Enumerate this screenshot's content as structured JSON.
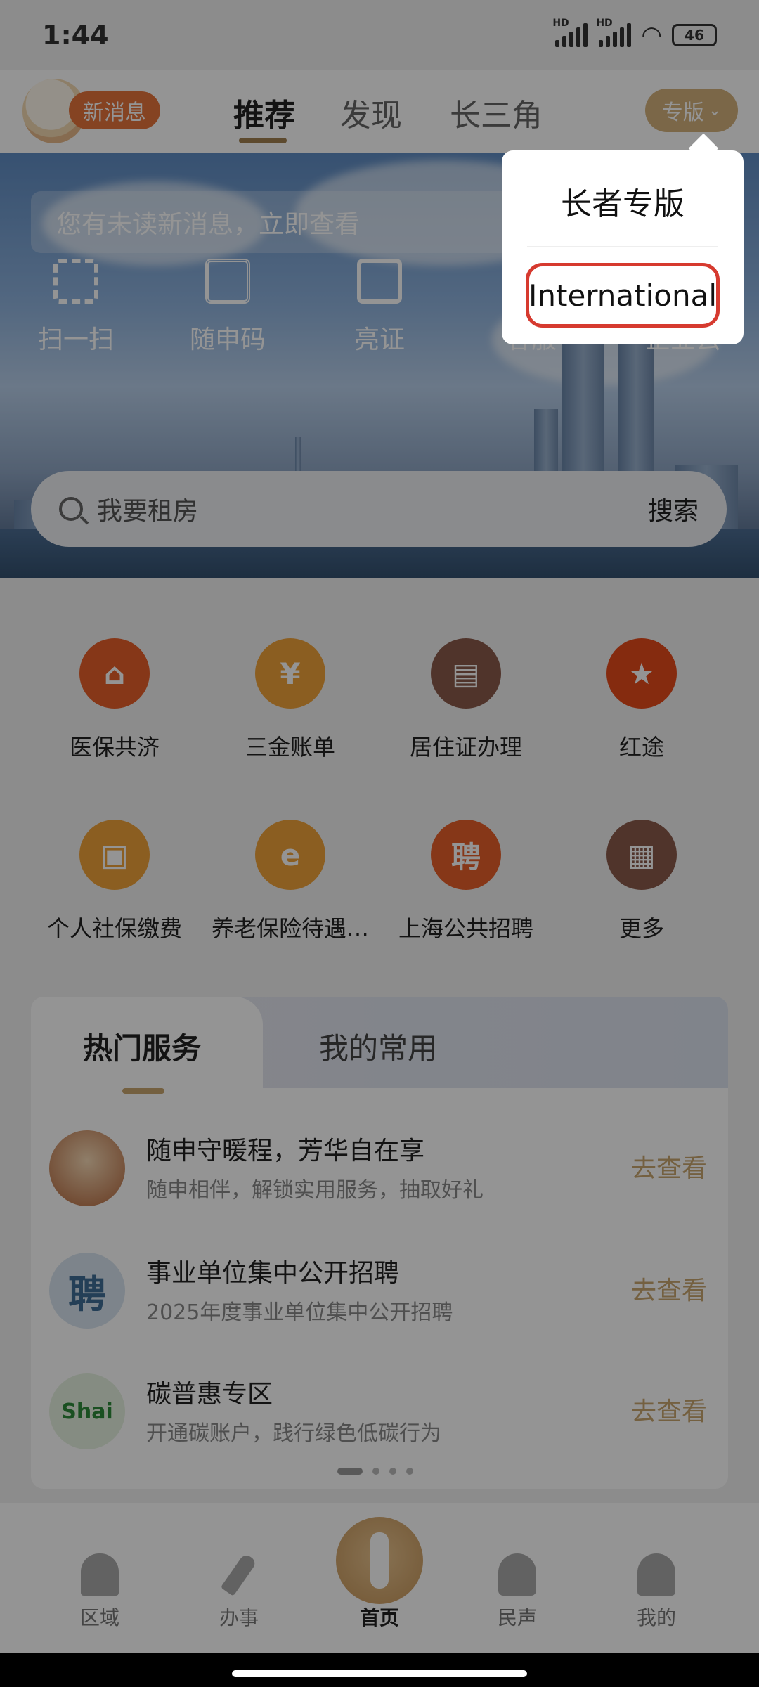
{
  "status_bar": {
    "time": "1:44",
    "battery": "46",
    "net1": "HD",
    "net2": "HD"
  },
  "top_nav": {
    "message_badge": "新消息",
    "tabs": [
      {
        "label": "推荐"
      },
      {
        "label": "发现"
      },
      {
        "label": "长三角"
      }
    ],
    "edition_button": "专版"
  },
  "banner": {
    "notice": "您有未读新消息，立即查看",
    "quick_actions": [
      {
        "label": "扫一扫",
        "icon": "scan-icon"
      },
      {
        "label": "随申码",
        "icon": "qr-code-icon"
      },
      {
        "label": "亮证",
        "icon": "id-card-icon"
      },
      {
        "label": "客服",
        "icon": "customer-service-icon"
      },
      {
        "label": "企业云",
        "icon": "enterprise-cloud-icon"
      }
    ],
    "search_placeholder": "我要租房",
    "search_button": "搜索"
  },
  "services": [
    {
      "label": "医保共济",
      "icon": "medical-insurance-icon",
      "color": "#e7602a"
    },
    {
      "label": "三金账单",
      "icon": "fund-bill-icon",
      "color": "#f0a23a"
    },
    {
      "label": "居住证办理",
      "icon": "residence-permit-icon",
      "color": "#8b5a4a"
    },
    {
      "label": "红途",
      "icon": "red-star-icon",
      "color": "#e54a1a"
    },
    {
      "label": "个人社保缴费",
      "icon": "social-security-icon",
      "color": "#f0a23a"
    },
    {
      "label": "养老保险待遇…",
      "icon": "pension-icon",
      "color": "#f0a23a"
    },
    {
      "label": "上海公共招聘",
      "icon": "recruit-icon",
      "color": "#e7602a",
      "glyph": "聘"
    },
    {
      "label": "更多",
      "icon": "more-apps-icon",
      "color": "#8b5a4a"
    }
  ],
  "hot_card": {
    "tabs": [
      {
        "label": "热门服务"
      },
      {
        "label": "我的常用"
      }
    ],
    "items": [
      {
        "title": "随申守暖程，芳华自在享",
        "subtitle": "随申相伴，解锁实用服务，抽取好礼",
        "action": "去查看",
        "glyph": ""
      },
      {
        "title": "事业单位集中公开招聘",
        "subtitle": "2025年度事业单位集中公开招聘",
        "action": "去查看",
        "glyph": "聘"
      },
      {
        "title": "碳普惠专区",
        "subtitle": "开通碳账户，践行绿色低碳行为",
        "action": "去查看",
        "glyph": "Shai"
      }
    ]
  },
  "bottom_tabs": [
    {
      "label": "区域"
    },
    {
      "label": "办事"
    },
    {
      "label": "首页"
    },
    {
      "label": "民声"
    },
    {
      "label": "我的"
    }
  ],
  "popup": {
    "option_elder": "长者专版",
    "option_international": "International"
  }
}
